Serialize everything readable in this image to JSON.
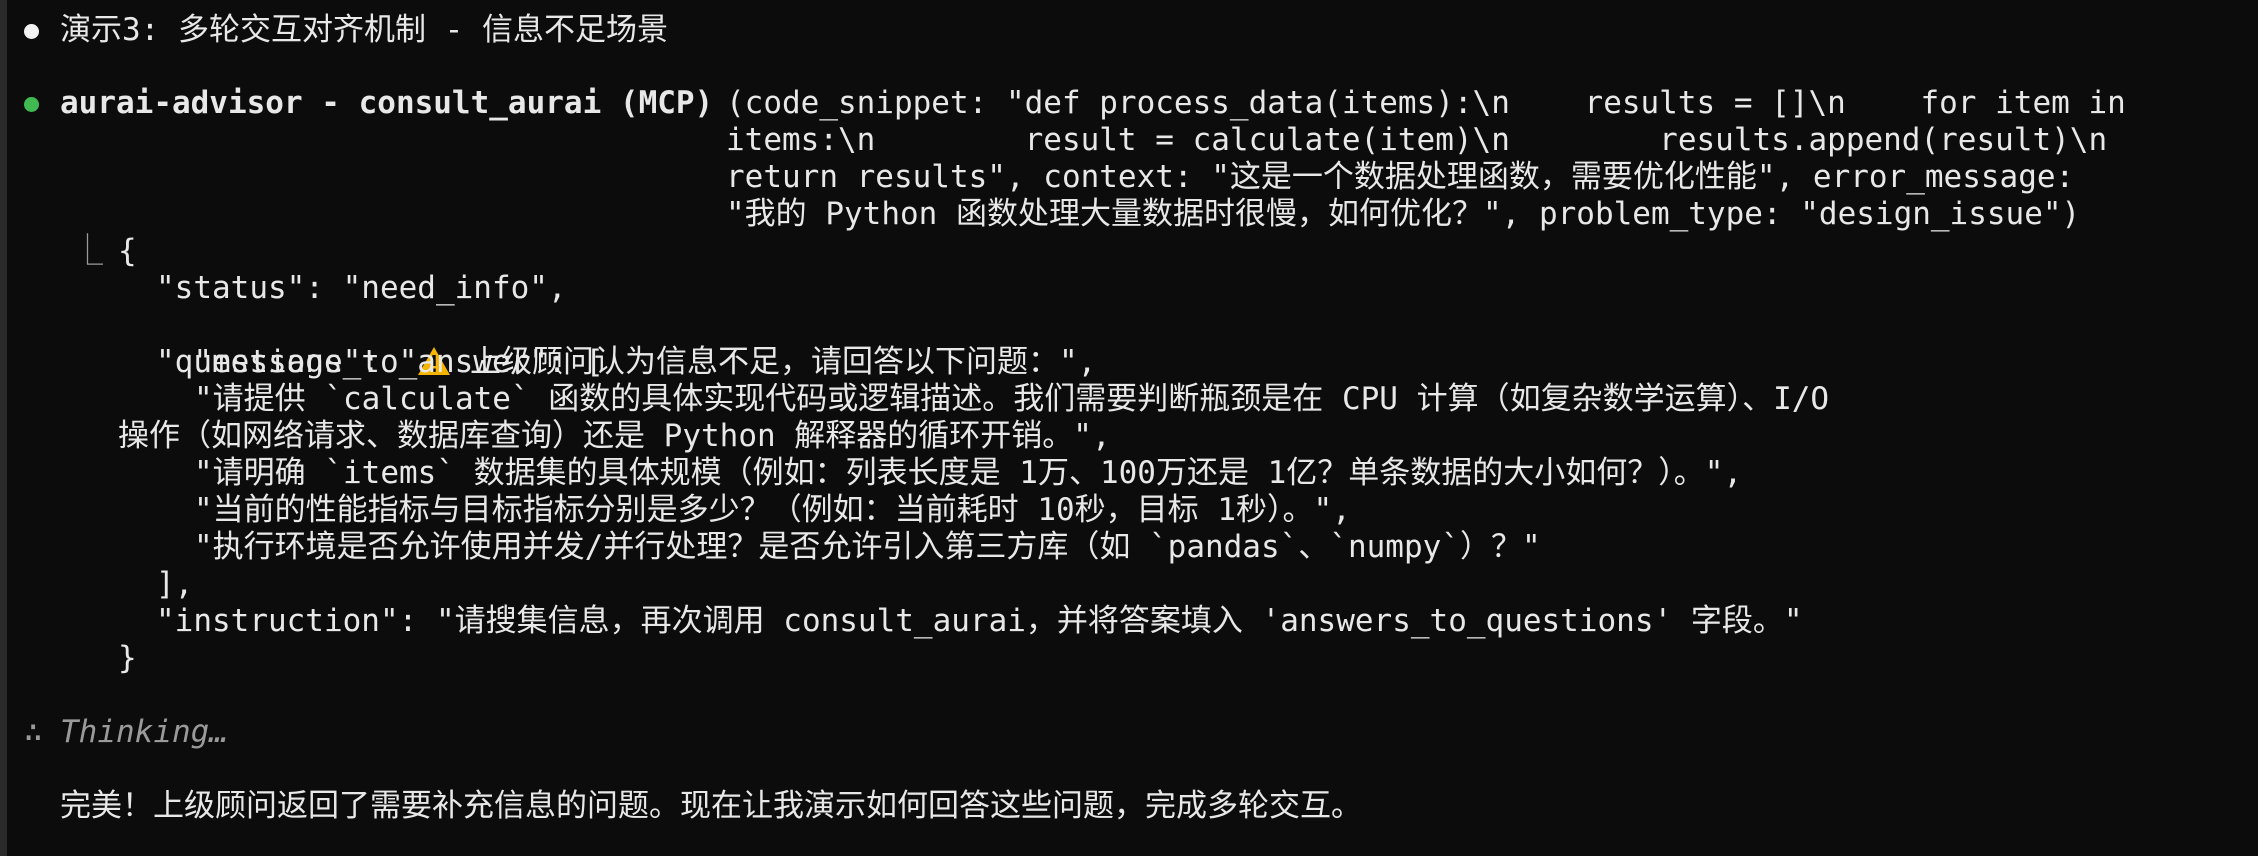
{
  "colors": {
    "background": "#0c0c0c",
    "text": "#e8e8e8",
    "bullet_white": "#f2f2f2",
    "bullet_green": "#3fb950",
    "warning": "#f5b400",
    "muted": "#9a9a9a"
  },
  "header": {
    "title": "演示3: 多轮交互对齐机制 - 信息不足场景"
  },
  "tool_call": {
    "name": "aurai-advisor - consult_aurai (MCP)",
    "args_lines": [
      "(code_snippet: \"def process_data(items):\\n    results = []\\n    for item in",
      "items:\\n        result = calculate(item)\\n        results.append(result)\\n",
      "return results\", context: \"这是一个数据处理函数，需要优化性能\", error_message:",
      "\"我的 Python 函数处理大量数据时很慢，如何优化？\", problem_type: \"design_issue\")"
    ]
  },
  "result": {
    "connector": "⎿",
    "open_brace": "{",
    "status_line": "\"status\": \"need_info\",",
    "message_prefix": "\"message\": \"",
    "warning_icon": "warning-icon",
    "message_text": "上级顾问认为信息不足，请回答以下问题：\",",
    "questions_key_line": "\"questions_to_answer\": [",
    "questions": [
      "\"请提供 `calculate` 函数的具体实现代码或逻辑描述。我们需要判断瓶颈是在 CPU 计算（如复杂数学运算）、I/O",
      "操作（如网络请求、数据库查询）还是 Python 解释器的循环开销。\",",
      "\"请明确 `items` 数据集的具体规模（例如：列表长度是 1万、100万还是 1亿？单条数据的大小如何？）。\",",
      "\"当前的性能指标与目标指标分别是多少？（例如：当前耗时 10秒，目标 1秒）。\",",
      "\"执行环境是否允许使用并发/并行处理？是否允许引入第三方库（如 `pandas`、`numpy`）？\""
    ],
    "questions_close": "],",
    "instruction_line": "\"instruction\": \"请搜集信息，再次调用 consult_aurai，并将答案填入 'answers_to_questions' 字段。\"",
    "close_brace": "}"
  },
  "thinking": {
    "icon": "∴",
    "label": "Thinking…"
  },
  "reply": {
    "text": "完美！上级顾问返回了需要补充信息的问题。现在让我演示如何回答这些问题，完成多轮交互。"
  }
}
